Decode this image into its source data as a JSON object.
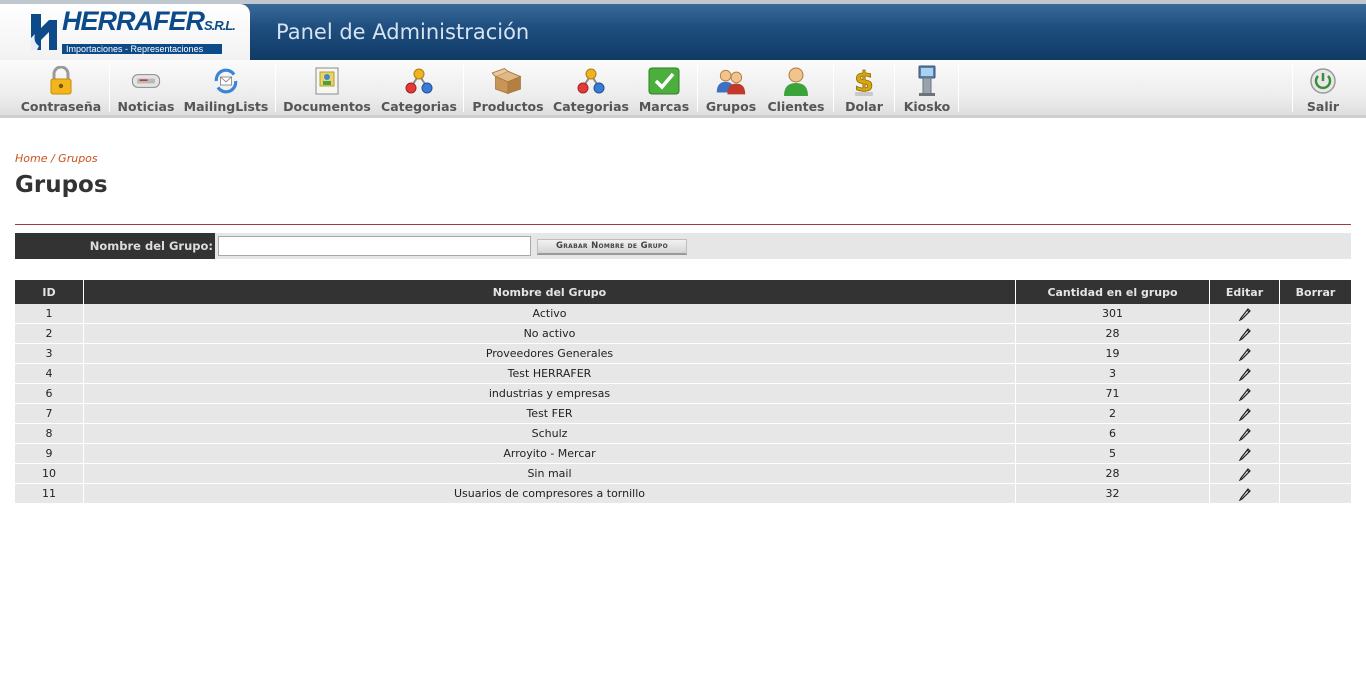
{
  "header": {
    "logo_name": "HERRAFER",
    "logo_suffix": "S.R.L.",
    "logo_tagline": "Importaciones - Representaciones",
    "panel_title": "Panel de Administración"
  },
  "toolbar": {
    "items": [
      {
        "label": "Contraseña",
        "icon": "lock-icon"
      },
      {
        "label": "Noticias",
        "icon": "newspaper-icon"
      },
      {
        "label": "MailingLists",
        "icon": "mail-sync-icon"
      },
      {
        "label": "Documentos",
        "icon": "document-icon"
      },
      {
        "label": "Categorias",
        "icon": "category-tree-icon"
      },
      {
        "label": "Productos",
        "icon": "box-icon"
      },
      {
        "label": "Categorias",
        "icon": "category-tree-icon"
      },
      {
        "label": "Marcas",
        "icon": "checkmark-icon"
      },
      {
        "label": "Grupos",
        "icon": "users-group-icon"
      },
      {
        "label": "Clientes",
        "icon": "user-icon"
      },
      {
        "label": "Dolar",
        "icon": "dollar-icon"
      },
      {
        "label": "Kiosko",
        "icon": "kiosk-icon"
      }
    ],
    "logout_label": "Salir"
  },
  "breadcrumb": "Home / Grupos",
  "page_title": "Grupos",
  "form": {
    "label": "Nombre del Grupo:",
    "value": "",
    "button": "Grabar Nombre de Grupo"
  },
  "table": {
    "headers": [
      "ID",
      "Nombre del Grupo",
      "Cantidad en el grupo",
      "Editar",
      "Borrar"
    ],
    "rows": [
      {
        "id": "1",
        "name": "Activo",
        "count": "301"
      },
      {
        "id": "2",
        "name": "No activo",
        "count": "28"
      },
      {
        "id": "3",
        "name": "Proveedores Generales",
        "count": "19"
      },
      {
        "id": "4",
        "name": "Test HERRAFER",
        "count": "3"
      },
      {
        "id": "6",
        "name": "industrias y empresas",
        "count": "71"
      },
      {
        "id": "7",
        "name": "Test FER",
        "count": "2"
      },
      {
        "id": "8",
        "name": "Schulz",
        "count": "6"
      },
      {
        "id": "9",
        "name": "Arroyito - Mercar",
        "count": "5"
      },
      {
        "id": "10",
        "name": "Sin mail",
        "count": "28"
      },
      {
        "id": "11",
        "name": "Usuarios de compresores a tornillo",
        "count": "32"
      }
    ]
  },
  "colors": {
    "header_blue": "#1f4f80",
    "accent_orange": "#c9531f",
    "dark_bar": "#333333",
    "row_gray": "#e7e7e7"
  }
}
